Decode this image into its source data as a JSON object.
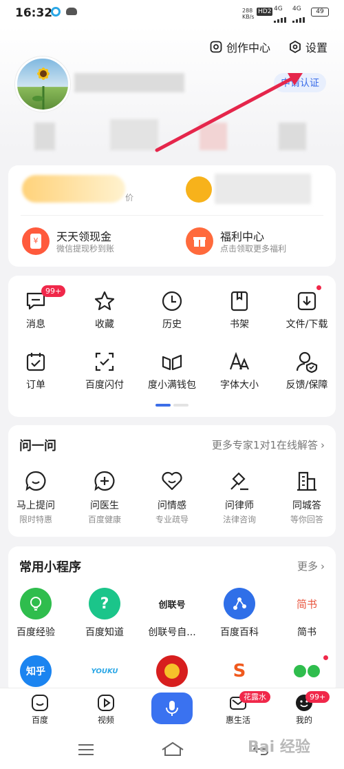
{
  "status_bar": {
    "time": "16:32",
    "net_speed": "288\nKB/s",
    "hd": "HD2",
    "signal1": "4G",
    "signal2": "4G",
    "battery": "49"
  },
  "header": {
    "creation_center": "创作中心",
    "settings": "设置",
    "verify": "申请认证"
  },
  "benefits": {
    "partial_text": "价",
    "items": [
      {
        "title": "天天领现金",
        "subtitle": "微信提现秒到账",
        "icon": "cash-envelope-icon"
      },
      {
        "title": "福利中心",
        "subtitle": "点击领取更多福利",
        "icon": "gift-icon"
      }
    ]
  },
  "tools": {
    "row1": [
      {
        "label": "消息",
        "icon": "message-icon",
        "badge": "99+"
      },
      {
        "label": "收藏",
        "icon": "star-icon"
      },
      {
        "label": "历史",
        "icon": "clock-icon"
      },
      {
        "label": "书架",
        "icon": "bookshelf-icon"
      },
      {
        "label": "文件/下载",
        "icon": "download-icon"
      }
    ],
    "row2": [
      {
        "label": "订单",
        "icon": "order-icon"
      },
      {
        "label": "百度闪付",
        "icon": "scan-pay-icon"
      },
      {
        "label": "度小满钱包",
        "icon": "wallet-icon"
      },
      {
        "label": "字体大小",
        "icon": "font-size-icon"
      },
      {
        "label": "反馈/保障",
        "icon": "feedback-icon"
      }
    ]
  },
  "ask": {
    "title": "问一问",
    "more": "更多专家1对1在线解答",
    "items": [
      {
        "label": "马上提问",
        "sub": "限时特惠",
        "icon": "chat-icon"
      },
      {
        "label": "问医生",
        "sub": "百度健康",
        "icon": "medical-icon"
      },
      {
        "label": "问情感",
        "sub": "专业疏导",
        "icon": "heart-icon"
      },
      {
        "label": "问律师",
        "sub": "法律咨询",
        "icon": "gavel-icon"
      },
      {
        "label": "同城答",
        "sub": "等你回答",
        "icon": "building-icon"
      }
    ]
  },
  "mini_programs": {
    "title": "常用小程序",
    "more": "更多",
    "items": [
      {
        "label": "百度经验",
        "icon": "bulb-app-icon",
        "color": "#2fbd4d"
      },
      {
        "label": "百度知道",
        "icon": "question-app-icon",
        "color": "#1bc58a",
        "glyph": "?"
      },
      {
        "label": "创联号自...",
        "icon": "chuanglian-app-icon",
        "color": "#ffffff",
        "glyph": "创联号"
      },
      {
        "label": "百度百科",
        "icon": "baike-app-icon",
        "color": "#2f6fe8"
      },
      {
        "label": "简书",
        "icon": "jianshu-app-icon",
        "color": "#ffffff",
        "glyph": "简书"
      }
    ],
    "row2": [
      {
        "icon": "zhihu-app-icon",
        "color": "#1b84f0",
        "glyph": "知乎"
      },
      {
        "icon": "youku-app-icon",
        "color": "#ffffff",
        "glyph": "YOUKU"
      },
      {
        "icon": "gov-service-app-icon",
        "color": "#d71e1e"
      },
      {
        "icon": "s-app-icon",
        "color": "#ffffff",
        "glyph": "S"
      },
      {
        "icon": "wechat-app-icon",
        "color": "#ffffff"
      }
    ]
  },
  "tabbar": {
    "items": [
      {
        "label": "百度",
        "icon": "baidu-home-icon"
      },
      {
        "label": "视频",
        "icon": "video-icon"
      },
      {
        "label": "",
        "icon": "microphone-icon"
      },
      {
        "label": "惠生活",
        "icon": "mail-icon",
        "badge": "花露水"
      },
      {
        "label": "我的",
        "icon": "me-icon",
        "badge": "99+"
      }
    ]
  },
  "watermark": "Bai 经验",
  "colors": {
    "accent": "#3c6ee8",
    "badge": "#f0284a",
    "arrow": "#e5264b",
    "mic": "#3a72f0"
  }
}
